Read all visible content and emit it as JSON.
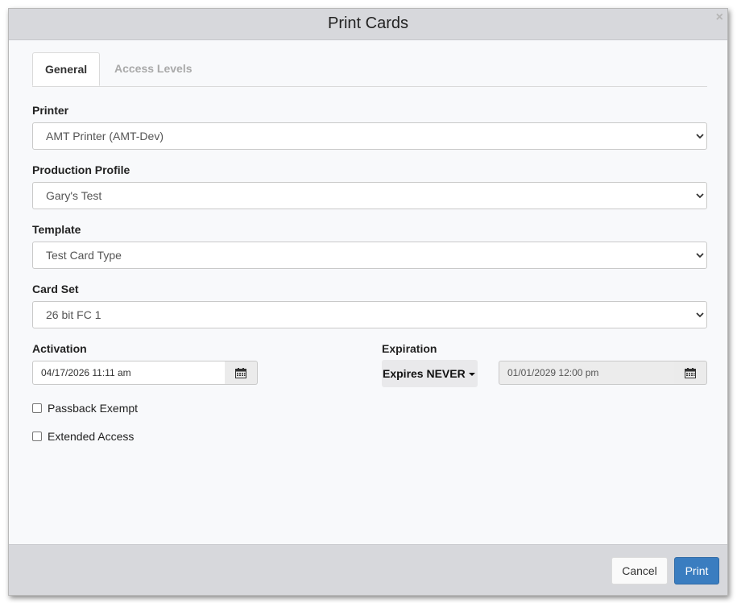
{
  "dialog": {
    "title": "Print Cards",
    "close_glyph": "×"
  },
  "tabs": [
    {
      "label": "General",
      "active": true
    },
    {
      "label": "Access Levels",
      "active": false
    }
  ],
  "fields": {
    "printer": {
      "label": "Printer",
      "value": "AMT Printer (AMT-Dev)"
    },
    "production_profile": {
      "label": "Production Profile",
      "value": "Gary's Test"
    },
    "template": {
      "label": "Template",
      "value": "Test Card Type"
    },
    "card_set": {
      "label": "Card Set",
      "value": "26 bit FC 1"
    },
    "activation": {
      "label": "Activation",
      "value": "04/17/2026 11:11 am"
    },
    "expiration": {
      "label": "Expiration",
      "mode": "Expires NEVER",
      "value": "01/01/2029 12:00 pm"
    }
  },
  "checkboxes": [
    {
      "label": "Passback Exempt",
      "checked": false
    },
    {
      "label": "Extended Access",
      "checked": false
    }
  ],
  "footer": {
    "cancel_label": "Cancel",
    "print_label": "Print"
  },
  "colors": {
    "header_bg": "#d7d8dc",
    "body_bg": "#f8f9fb",
    "primary_button": "#3a7dc0"
  },
  "icons": {
    "close": "close-icon",
    "calendar": "calendar-icon",
    "select_arrow": "chevron-down-icon"
  }
}
